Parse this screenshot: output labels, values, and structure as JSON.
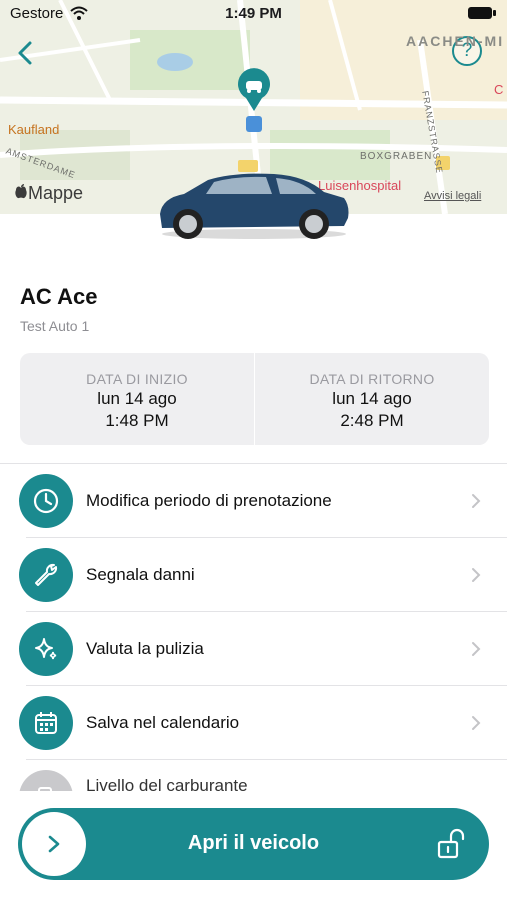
{
  "status_bar": {
    "carrier": "Gestore",
    "time": "1:49 PM"
  },
  "map": {
    "labels": {
      "aachen": "AACHEN-MI",
      "kaufland": "Kaufland",
      "boxgraben": "BOXGRABEN",
      "franzstrasse": "FRANZSTRASSE",
      "amsterdamer": "AMSTERDAME",
      "luisenhospital": "Luisenhospital",
      "c_poi": "C"
    },
    "attribution": "Mappe",
    "legal": "Avvisi legali",
    "help_symbol": "?"
  },
  "vehicle": {
    "name": "AC Ace",
    "subtitle": "Test Auto 1"
  },
  "booking": {
    "start": {
      "label": "DATA DI INIZIO",
      "date": "lun 14 ago",
      "time": "1:48 PM"
    },
    "end": {
      "label": "DATA DI RITORNO",
      "date": "lun 14 ago",
      "time": "2:48 PM"
    }
  },
  "actions": [
    {
      "label": "Modifica periodo di prenotazione",
      "icon": "clock-icon"
    },
    {
      "label": "Segnala danni",
      "icon": "wrench-icon"
    },
    {
      "label": "Valuta la pulizia",
      "icon": "sparkle-icon"
    },
    {
      "label": "Salva nel calendario",
      "icon": "calendar-icon"
    },
    {
      "label": "Livello del carburante",
      "icon": "fuel-icon"
    }
  ],
  "bottom": {
    "open_label": "Apri il veicolo"
  },
  "colors": {
    "accent": "#1b8a8f",
    "period_bg": "#efeff1"
  }
}
